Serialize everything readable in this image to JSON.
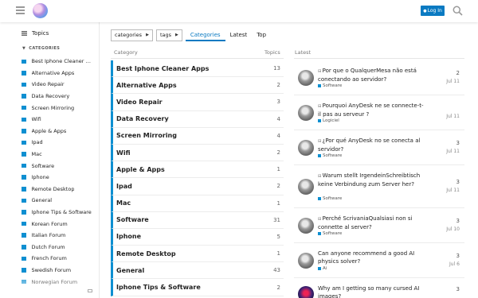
{
  "header": {
    "login_label": "Log In",
    "login_icon": "user-icon",
    "colors": {
      "accent": "#0a7ac2",
      "category": "#0e8fd1"
    }
  },
  "sidebar": {
    "topics_label": "Topics",
    "section_label": "CATEGORIES",
    "items": [
      "Best Iphone Cleaner Apps",
      "Alternative Apps",
      "Video Repair",
      "Data Recovery",
      "Screen Mirroring",
      "Wifi",
      "Apple & Apps",
      "Ipad",
      "Mac",
      "Software",
      "Iphone",
      "Remote Desktop",
      "General",
      "Iphone Tips & Software",
      "Korean Forum",
      "Italian Forum",
      "Dutch Forum",
      "French Forum",
      "Swedish Forum",
      "Norwegian Forum"
    ]
  },
  "nav": {
    "categories_dd": "categories",
    "tags_dd": "tags",
    "links": [
      "Categories",
      "Latest",
      "Top"
    ]
  },
  "categories": {
    "header_category": "Category",
    "header_topics": "Topics",
    "rows": [
      {
        "name": "Best Iphone Cleaner Apps",
        "count": "13"
      },
      {
        "name": "Alternative Apps",
        "count": "2"
      },
      {
        "name": "Video Repair",
        "count": "3"
      },
      {
        "name": "Data Recovery",
        "count": "4"
      },
      {
        "name": "Screen Mirroring",
        "count": "4"
      },
      {
        "name": "Wifi",
        "count": "2"
      },
      {
        "name": "Apple & Apps",
        "count": "1"
      },
      {
        "name": "Ipad",
        "count": "2"
      },
      {
        "name": "Mac",
        "count": "1"
      },
      {
        "name": "Software",
        "count": "31"
      },
      {
        "name": "Iphone",
        "count": "5"
      },
      {
        "name": "Remote Desktop",
        "count": "1"
      },
      {
        "name": "General",
        "count": "43"
      },
      {
        "name": "Iphone Tips & Software",
        "count": "2"
      }
    ]
  },
  "latest": {
    "header": "Latest",
    "rows": [
      {
        "title": "Por que o QualquerMesa não está conectando ao servidor?",
        "category": "Software",
        "replies": "2",
        "date": "Jul 11"
      },
      {
        "title": "Pourquoi AnyDesk ne se connecte-t-il pas au serveur ?",
        "category": "Logiciel",
        "replies": "",
        "date": "Jul 11"
      },
      {
        "title": "¿Por qué AnyDesk no se conecta al servidor?",
        "category": "Software",
        "replies": "3",
        "date": "Jul 11"
      },
      {
        "title": "Warum stellt IrgendeinSchreibtisch keine Verbindung zum Server her?",
        "category": "Software",
        "replies": "3",
        "date": "Jul 11"
      },
      {
        "title": "Perché ScrivaniaQualsiasi non si connette al server?",
        "category": "Software",
        "replies": "3",
        "date": "Jul 10"
      },
      {
        "title": "Can anyone recommend a good AI physics solver?",
        "category": "Ai",
        "replies": "3",
        "date": "Jul 6"
      },
      {
        "title": "Why am I getting so many cursed AI images?",
        "category": "",
        "replies": "3",
        "date": ""
      }
    ]
  }
}
